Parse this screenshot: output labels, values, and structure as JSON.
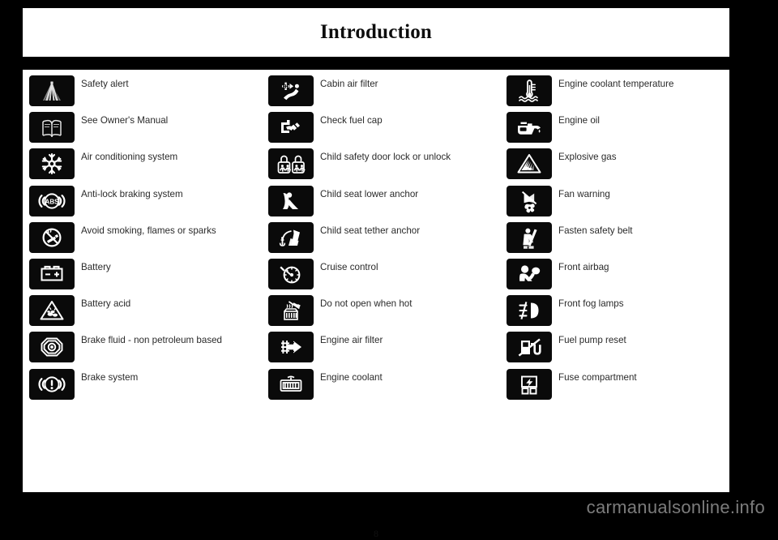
{
  "page": {
    "title": "Introduction",
    "page_number": "8",
    "background_color": "#000000",
    "sheet_color": "#ffffff",
    "icon_box_color": "#0a0a0a",
    "text_color": "#2a2a2a"
  },
  "watermark": {
    "text": "carmanualsonline.info",
    "color": "#7c7c7c"
  },
  "columns": [
    {
      "id": "column-1",
      "rows": [
        {
          "icon": "safety-alert-icon",
          "label": "Safety alert"
        },
        {
          "icon": "see-owners-manual-icon",
          "label": "See Owner's Manual"
        },
        {
          "icon": "air-conditioning-icon",
          "label": "Air conditioning system"
        },
        {
          "icon": "anti-lock-braking-icon",
          "label": "Anti-lock braking system"
        },
        {
          "icon": "no-smoking-flames-sparks-icon",
          "label": "Avoid smoking, flames or sparks"
        },
        {
          "icon": "battery-icon",
          "label": "Battery"
        },
        {
          "icon": "battery-acid-icon",
          "label": "Battery acid"
        },
        {
          "icon": "brake-fluid-icon",
          "label": "Brake fluid - non petroleum based"
        },
        {
          "icon": "brake-system-icon",
          "label": "Brake system"
        }
      ]
    },
    {
      "id": "column-2",
      "rows": [
        {
          "icon": "cabin-air-filter-icon",
          "label": "Cabin air filter"
        },
        {
          "icon": "check-fuel-cap-icon",
          "label": "Check fuel cap"
        },
        {
          "icon": "child-safety-door-lock-icon",
          "label": "Child safety door lock or unlock"
        },
        {
          "icon": "child-seat-lower-anchor-icon",
          "label": "Child seat lower anchor"
        },
        {
          "icon": "child-seat-tether-anchor-icon",
          "label": "Child seat tether anchor"
        },
        {
          "icon": "cruise-control-icon",
          "label": "Cruise control"
        },
        {
          "icon": "do-not-open-when-hot-icon",
          "label": "Do not open when hot"
        },
        {
          "icon": "engine-air-filter-icon",
          "label": "Engine air filter"
        },
        {
          "icon": "engine-coolant-icon",
          "label": "Engine coolant"
        }
      ]
    },
    {
      "id": "column-3",
      "rows": [
        {
          "icon": "engine-coolant-temperature-icon",
          "label": "Engine coolant temperature"
        },
        {
          "icon": "engine-oil-icon",
          "label": "Engine oil"
        },
        {
          "icon": "explosive-gas-icon",
          "label": "Explosive gas"
        },
        {
          "icon": "fan-warning-icon",
          "label": "Fan warning"
        },
        {
          "icon": "fasten-safety-belt-icon",
          "label": "Fasten safety belt"
        },
        {
          "icon": "front-airbag-icon",
          "label": "Front airbag"
        },
        {
          "icon": "front-fog-lamps-icon",
          "label": "Front fog lamps"
        },
        {
          "icon": "fuel-pump-reset-icon",
          "label": "Fuel pump reset"
        },
        {
          "icon": "fuse-compartment-icon",
          "label": "Fuse compartment"
        }
      ]
    }
  ]
}
